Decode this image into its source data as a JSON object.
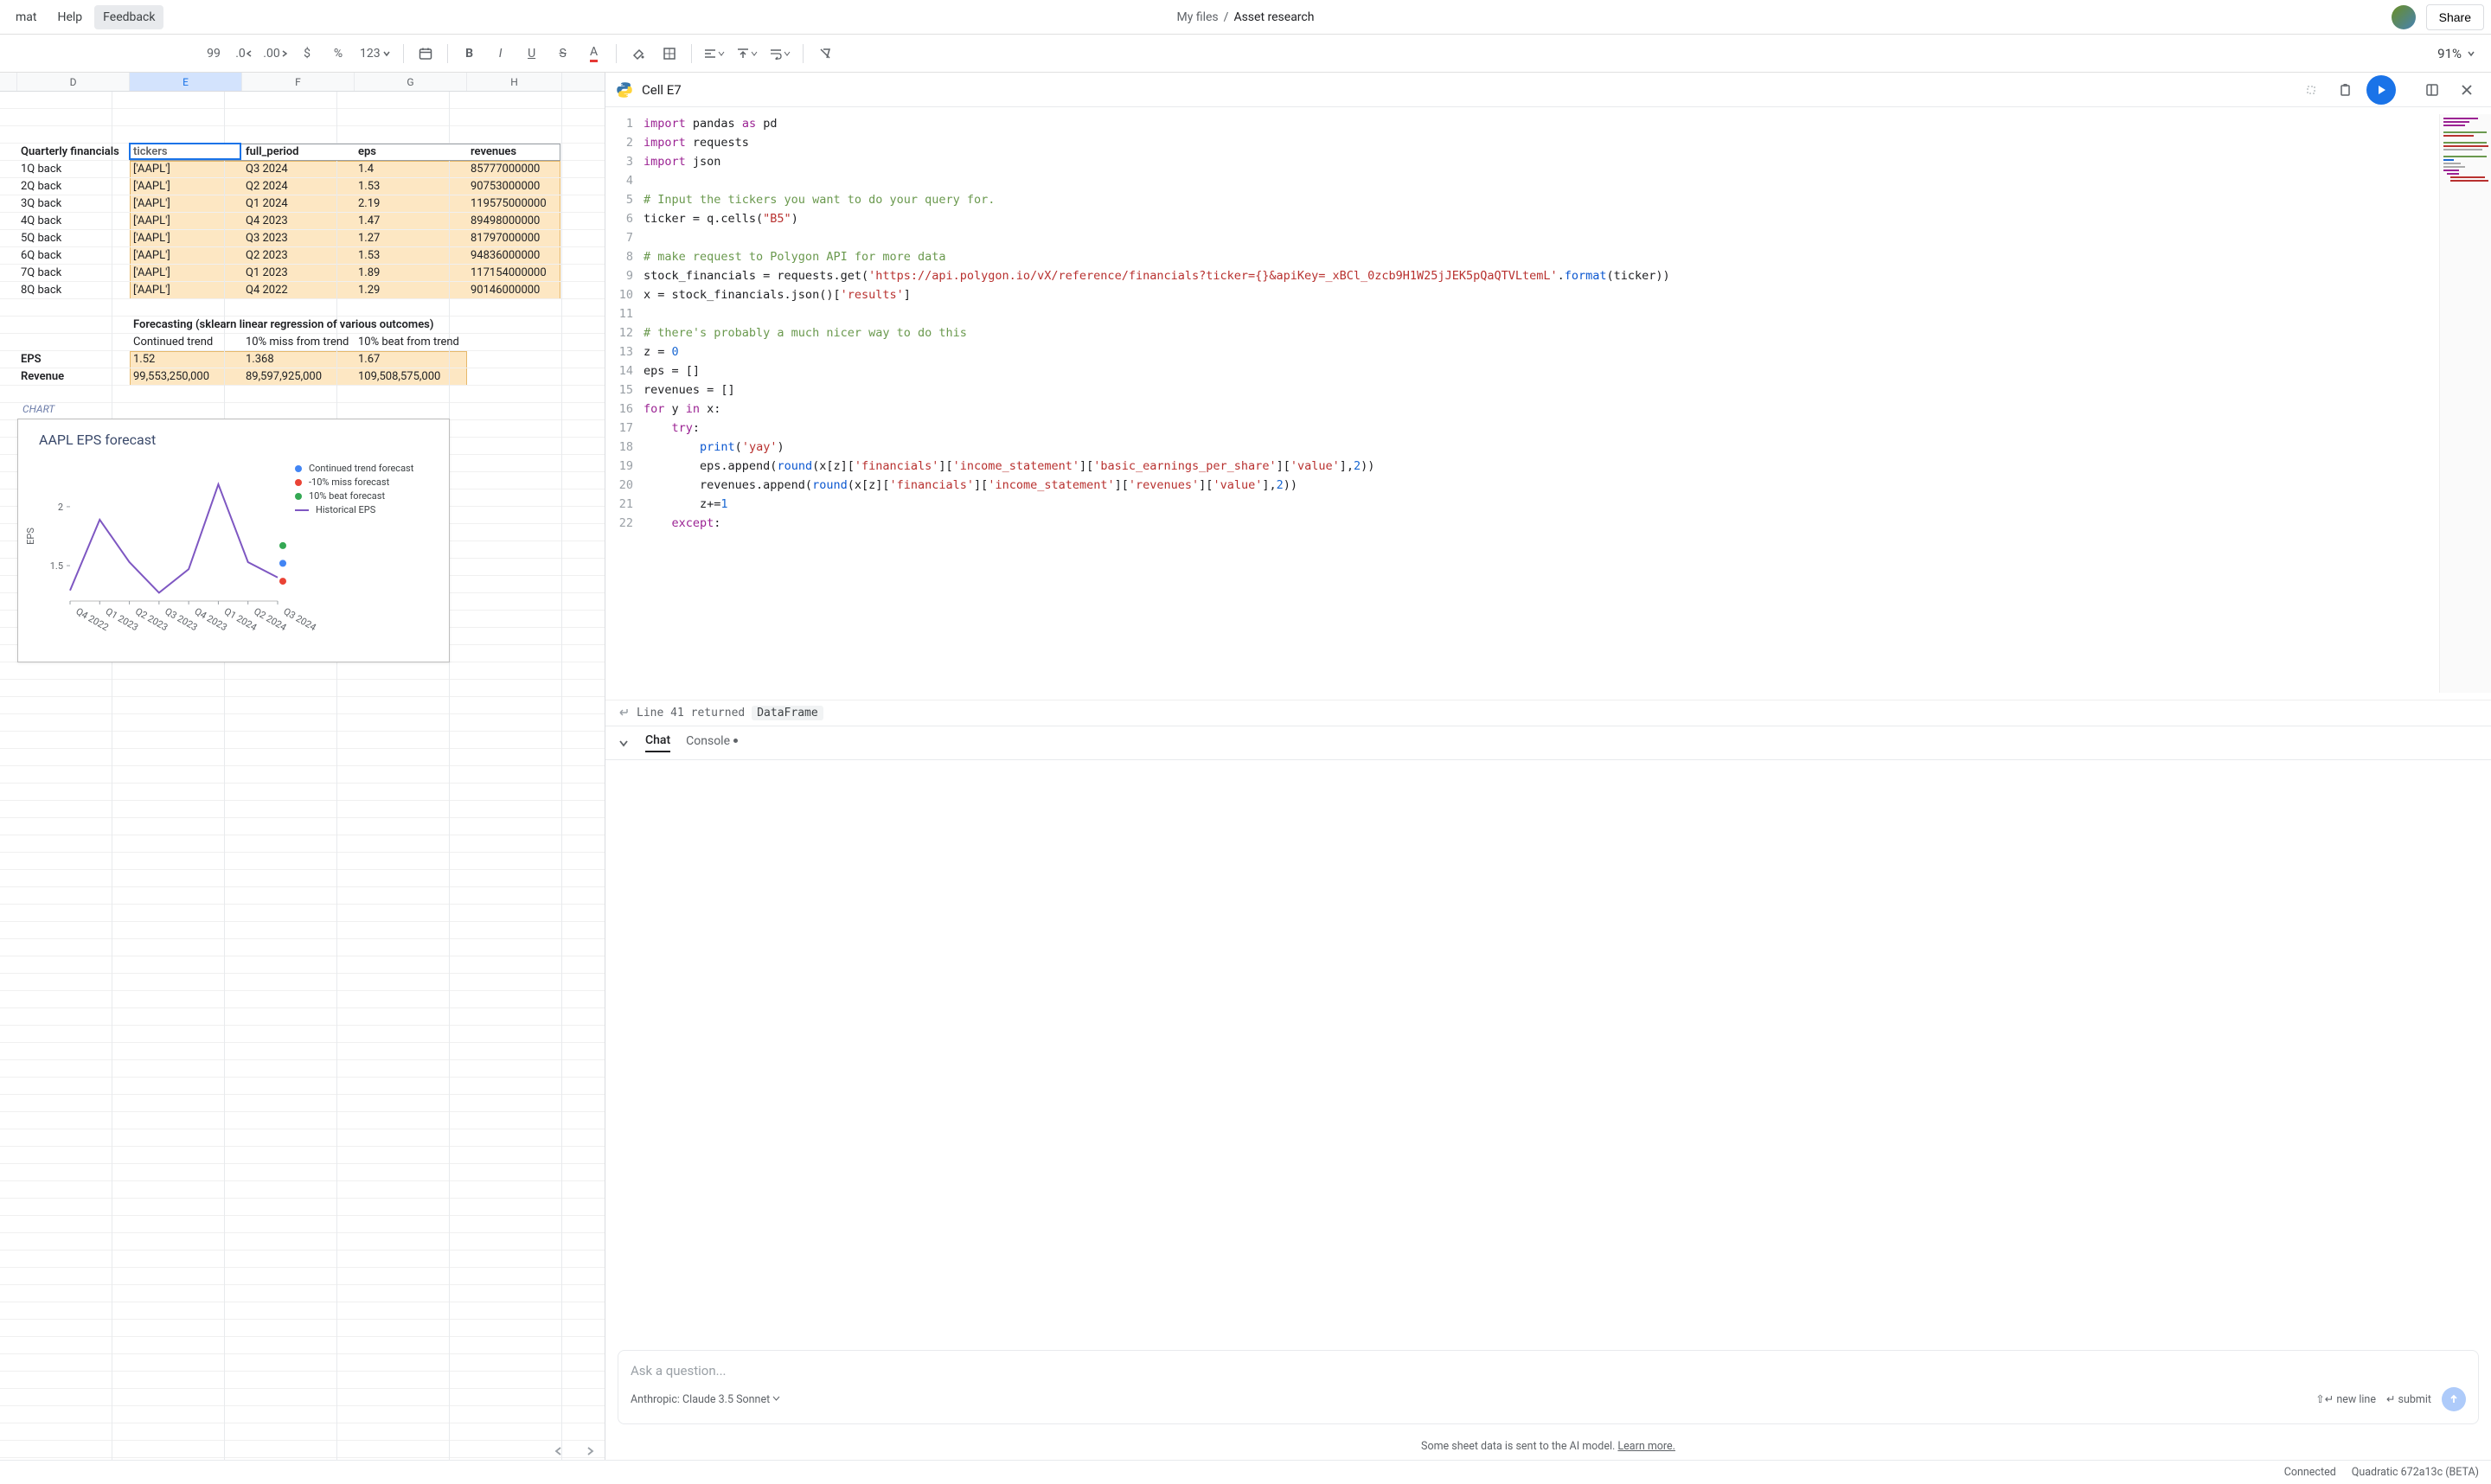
{
  "menu": {
    "items": [
      "mat",
      "Help",
      "Feedback"
    ],
    "selected": 2
  },
  "breadcrumb": {
    "root": "My files",
    "sep": "/",
    "current": "Asset research"
  },
  "share_label": "Share",
  "toolbar": {
    "ninety_nine": "99",
    "decr_dec": ".0",
    "incr_dec": ".00",
    "currency": "$",
    "percent": "%",
    "num_fmt": "123",
    "zoom": "91%"
  },
  "code_header": {
    "lang": "python",
    "cell_ref": "Cell E7"
  },
  "sheet": {
    "columns": [
      {
        "label": "D",
        "w": 130
      },
      {
        "label": "E",
        "w": 130,
        "selected": true
      },
      {
        "label": "F",
        "w": 130
      },
      {
        "label": "G",
        "w": 130
      },
      {
        "label": "H",
        "w": 110
      }
    ],
    "active_cell": "E7",
    "section1_title": "Quarterly financials",
    "headers1": [
      "tickers",
      "full_period",
      "eps",
      "revenues"
    ],
    "row_labels": [
      "1Q back",
      "2Q back",
      "3Q back",
      "4Q back",
      "5Q back",
      "6Q back",
      "7Q back",
      "8Q back"
    ],
    "rows": [
      [
        "['AAPL']",
        "Q3 2024",
        "1.4",
        "85777000000"
      ],
      [
        "['AAPL']",
        "Q2 2024",
        "1.53",
        "90753000000"
      ],
      [
        "['AAPL']",
        "Q1 2024",
        "2.19",
        "119575000000"
      ],
      [
        "['AAPL']",
        "Q4 2023",
        "1.47",
        "89498000000"
      ],
      [
        "['AAPL']",
        "Q3 2023",
        "1.27",
        "81797000000"
      ],
      [
        "['AAPL']",
        "Q2 2023",
        "1.53",
        "94836000000"
      ],
      [
        "['AAPL']",
        "Q1 2023",
        "1.89",
        "117154000000"
      ],
      [
        "['AAPL']",
        "Q4 2022",
        "1.29",
        "90146000000"
      ]
    ],
    "section2_title": "Forecasting (sklearn linear regression of various outcomes)",
    "headers2": [
      "Continued trend",
      "10% miss from trend",
      "10% beat from trend"
    ],
    "row_labels2": [
      "EPS",
      "Revenue"
    ],
    "rows2": [
      [
        "1.52",
        "1.368",
        "1.67"
      ],
      [
        "99,553,250,000",
        "89,597,925,000",
        "109,508,575,000"
      ]
    ],
    "chart_label": "CHART"
  },
  "chart_data": {
    "type": "line",
    "title": "AAPL EPS forecast",
    "xlabel": "",
    "ylabel": "EPS",
    "ylim": [
      1.2,
      2.3
    ],
    "categories": [
      "Q4 2022",
      "Q1 2023",
      "Q2 2023",
      "Q3 2023",
      "Q4 2023",
      "Q1 2024",
      "Q2 2024",
      "Q3 2024"
    ],
    "series": [
      {
        "name": "Historical EPS",
        "type": "line",
        "color": "#7e57c2",
        "values": [
          1.29,
          1.89,
          1.53,
          1.27,
          1.47,
          2.19,
          1.53,
          1.4
        ]
      }
    ],
    "forecast_points": [
      {
        "name": "Continued trend forecast",
        "color": "#4285f4",
        "x": "Q3 2024",
        "y": 1.52
      },
      {
        "name": "-10% miss forecast",
        "color": "#ea4335",
        "x": "Q3 2024",
        "y": 1.368
      },
      {
        "name": "10% beat forecast",
        "color": "#34a853",
        "x": "Q3 2024",
        "y": 1.67
      }
    ],
    "y_ticks": [
      1.5,
      2
    ]
  },
  "code": {
    "return_line_prefix": "Line 41 returned",
    "return_type": "DataFrame",
    "lines": [
      [
        [
          "kw",
          "import"
        ],
        [
          "",
          " pandas "
        ],
        [
          "kw",
          "as"
        ],
        [
          "",
          " pd"
        ]
      ],
      [
        [
          "kw",
          "import"
        ],
        [
          "",
          " requests"
        ]
      ],
      [
        [
          "kw",
          "import"
        ],
        [
          "",
          " json"
        ]
      ],
      [],
      [
        [
          "cmt",
          "# Input the tickers you want to do your query for."
        ]
      ],
      [
        [
          "",
          "ticker = q.cells("
        ],
        [
          "str",
          "\"B5\""
        ],
        [
          "",
          ")"
        ]
      ],
      [],
      [
        [
          "cmt",
          "# make request to Polygon API for more data"
        ]
      ],
      [
        [
          "",
          "stock_financials = requests.get("
        ],
        [
          "str",
          "'https://api.polygon.io/vX/reference/financials?ticker={}&apiKey=_xBCl_0zcb9H1W25jJEK5pQaQTVLtemL'"
        ],
        [
          "",
          "."
        ],
        [
          "fn",
          "format"
        ],
        [
          "",
          "(ticker))"
        ]
      ],
      [
        [
          "",
          "x = stock_financials.json()["
        ],
        [
          "str",
          "'results'"
        ],
        [
          "",
          "]"
        ]
      ],
      [],
      [
        [
          "cmt",
          "# there's probably a much nicer way to do this"
        ]
      ],
      [
        [
          "",
          "z = "
        ],
        [
          "num",
          "0"
        ]
      ],
      [
        [
          "",
          "eps = []"
        ]
      ],
      [
        [
          "",
          "revenues = []"
        ]
      ],
      [
        [
          "kw",
          "for"
        ],
        [
          "",
          " y "
        ],
        [
          "kw",
          "in"
        ],
        [
          "",
          " x:"
        ]
      ],
      [
        [
          "",
          "    "
        ],
        [
          "kw",
          "try"
        ],
        [
          "",
          ":"
        ]
      ],
      [
        [
          "",
          "        "
        ],
        [
          "fn",
          "print"
        ],
        [
          "",
          "("
        ],
        [
          "str",
          "'yay'"
        ],
        [
          "",
          ")"
        ]
      ],
      [
        [
          "",
          "        eps.append("
        ],
        [
          "fn",
          "round"
        ],
        [
          "",
          "(x[z]["
        ],
        [
          "str",
          "'financials'"
        ],
        [
          "",
          "]["
        ],
        [
          "str",
          "'income_statement'"
        ],
        [
          "",
          "]["
        ],
        [
          "str",
          "'basic_earnings_per_share'"
        ],
        [
          "",
          "]["
        ],
        [
          "str",
          "'value'"
        ],
        [
          "",
          "],"
        ],
        [
          "num",
          "2"
        ],
        [
          "",
          "))"
        ]
      ],
      [
        [
          "",
          "        revenues.append("
        ],
        [
          "fn",
          "round"
        ],
        [
          "",
          "(x[z]["
        ],
        [
          "str",
          "'financials'"
        ],
        [
          "",
          "]["
        ],
        [
          "str",
          "'income_statement'"
        ],
        [
          "",
          "]["
        ],
        [
          "str",
          "'revenues'"
        ],
        [
          "",
          "]["
        ],
        [
          "str",
          "'value'"
        ],
        [
          "",
          "],"
        ],
        [
          "num",
          "2"
        ],
        [
          "",
          "))"
        ]
      ],
      [
        [
          "",
          "        z+="
        ],
        [
          "num",
          "1"
        ]
      ],
      [
        [
          "",
          "    "
        ],
        [
          "kw",
          "except"
        ],
        [
          "",
          ":"
        ]
      ]
    ]
  },
  "chat": {
    "tabs": [
      "Chat",
      "Console"
    ],
    "active_tab": 0,
    "placeholder": "Ask a question...",
    "model_prefix": "Anthropic:",
    "model": "Claude 3.5 Sonnet",
    "hint_newline": "new line",
    "hint_submit": "submit",
    "notice": "Some sheet data is sent to the AI model.",
    "notice_link": "Learn more."
  },
  "status": {
    "connected": "Connected",
    "version": "Quadratic 672a13c (BETA)"
  }
}
